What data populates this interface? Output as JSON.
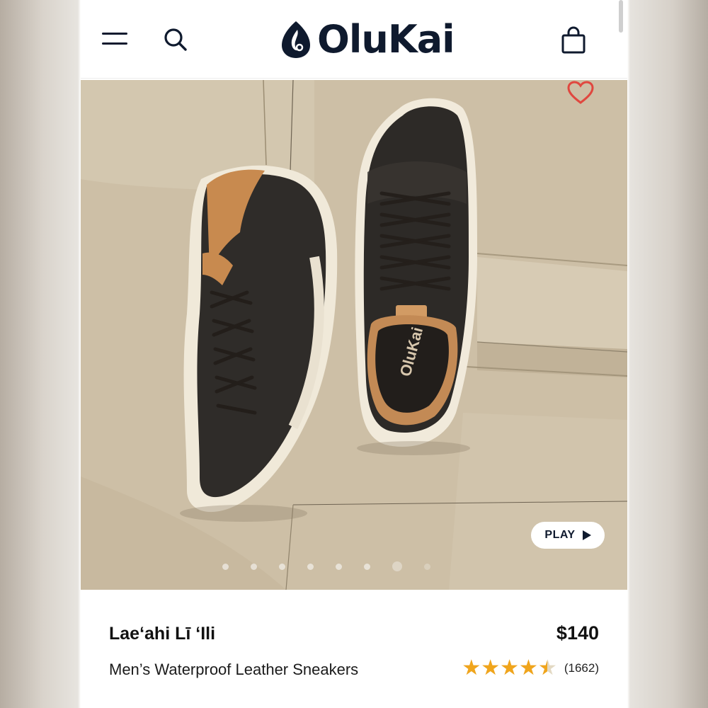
{
  "header": {
    "brand": "OluKai",
    "menu_icon": "hamburger-menu-icon",
    "search_icon": "search-icon",
    "bag_icon": "shopping-bag-icon"
  },
  "media": {
    "play_label": "PLAY",
    "favorite_icon": "heart-icon",
    "carousel_total": 8,
    "carousel_active_index": 7,
    "insole_brand": "OluKai"
  },
  "product": {
    "name": "Lae‘ahi Lī ‘Ili",
    "price": "$140",
    "subtitle": "Men’s Waterproof Leather Sneakers",
    "rating": 4.5,
    "rating_max": 5,
    "review_count": "(1662)"
  },
  "colors": {
    "brand_navy": "#0f1a2e",
    "heart_red": "#e0473f",
    "star_gold": "#f0a51c"
  }
}
